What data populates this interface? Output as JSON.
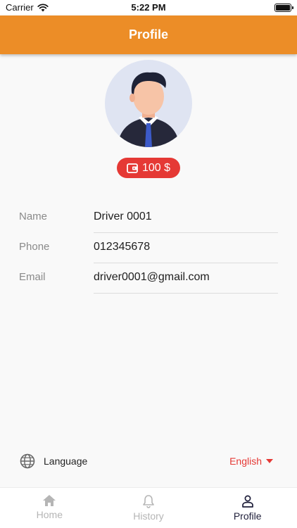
{
  "status_bar": {
    "carrier": "Carrier",
    "time": "5:22 PM"
  },
  "app_bar": {
    "title": "Profile"
  },
  "wallet": {
    "amount": "100 $",
    "color": "#e53935"
  },
  "profile": {
    "fields": [
      {
        "label": "Name",
        "value": "Driver 0001"
      },
      {
        "label": "Phone",
        "value": "012345678"
      },
      {
        "label": "Email",
        "value": "driver0001@gmail.com"
      }
    ]
  },
  "language": {
    "label": "Language",
    "selected": "English"
  },
  "bottom_nav": {
    "tabs": [
      {
        "label": "Home",
        "icon": "home-icon",
        "active": false
      },
      {
        "label": "History",
        "icon": "bell-icon",
        "active": false
      },
      {
        "label": "Profile",
        "icon": "person-icon",
        "active": true
      }
    ]
  },
  "colors": {
    "accent": "#ec8d27",
    "danger": "#e53935",
    "active_tab": "#1f1f3a",
    "inactive_tab": "#b5b5b5"
  }
}
